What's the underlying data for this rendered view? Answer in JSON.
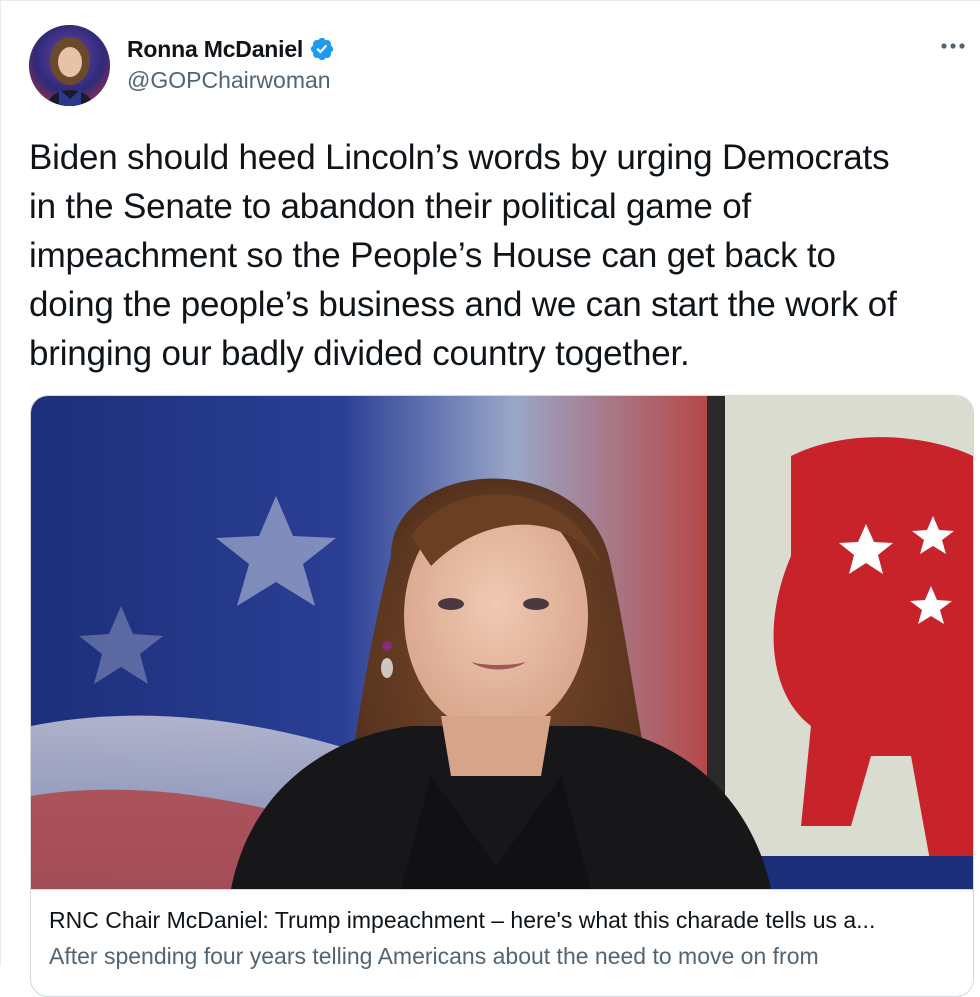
{
  "author": {
    "name": "Ronna McDaniel",
    "handle": "@GOPChairwoman",
    "verified_icon": "verified-badge-icon",
    "verified_color": "#1d9bf0"
  },
  "tweet": {
    "text": "Biden should heed Lincoln’s words by urging Democrats\nin the Senate to abandon their political game of\nimpeachment so the People’s House can get back to\ndoing the people’s business and we can start the work of\nbringing our badly divided country together."
  },
  "menu": {
    "icon": "more-horizontal-icon"
  },
  "link_card": {
    "title": "RNC Chair McDaniel: Trump impeachment – here's what this charade tells us a...",
    "description": "After spending four years telling Americans about the need to move on from"
  },
  "colors": {
    "text_primary": "#0f1419",
    "text_secondary": "#536471",
    "border": "#cfd9de",
    "accent": "#1d9bf0"
  }
}
